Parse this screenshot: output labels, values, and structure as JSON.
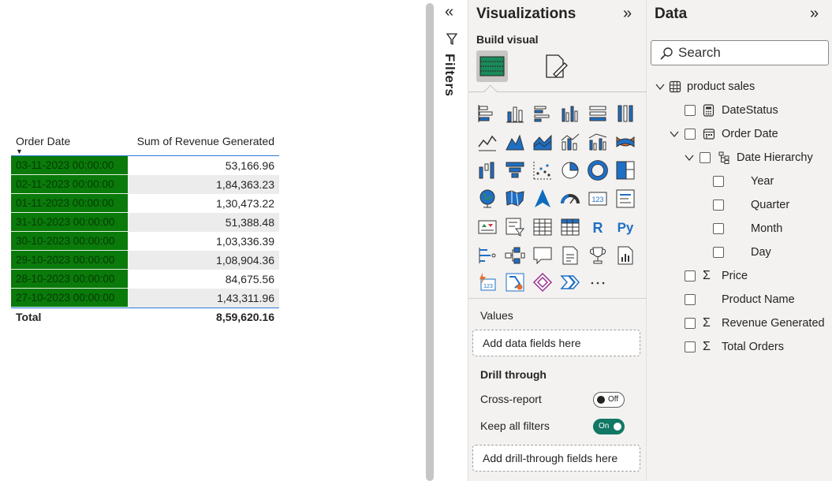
{
  "table": {
    "col_date": "Order Date",
    "col_revenue": "Sum of Revenue Generated",
    "rows": [
      {
        "date": "03-11-2023 00:00:00",
        "revenue": "53,166.96"
      },
      {
        "date": "02-11-2023 00:00:00",
        "revenue": "1,84,363.23"
      },
      {
        "date": "01-11-2023 00:00:00",
        "revenue": "1,30,473.22"
      },
      {
        "date": "31-10-2023 00:00:00",
        "revenue": "51,388.48"
      },
      {
        "date": "30-10-2023 00:00:00",
        "revenue": "1,03,336.39"
      },
      {
        "date": "29-10-2023 00:00:00",
        "revenue": "1,08,904.36"
      },
      {
        "date": "28-10-2023 00:00:00",
        "revenue": "84,675.56"
      },
      {
        "date": "27-10-2023 00:00:00",
        "revenue": "1,43,311.96"
      }
    ],
    "total_label": "Total",
    "total_value": "8,59,620.16",
    "date_cell_color": "#0a7a0a"
  },
  "filters": {
    "label": "Filters"
  },
  "visualizations": {
    "title": "Visualizations",
    "build_visual": "Build visual",
    "values_label": "Values",
    "values_drop": "Add data fields here",
    "drill_label": "Drill through",
    "cross_report": "Cross-report",
    "cross_toggle": "Off",
    "keep_filters": "Keep all filters",
    "keep_toggle": "On",
    "drill_drop": "Add drill-through fields here",
    "accent": "#117865"
  },
  "data_pane": {
    "title": "Data",
    "search_placeholder": "Search",
    "table_name": "product sales",
    "fields": {
      "date_status": "DateStatus",
      "order_date": "Order Date",
      "date_hierarchy": "Date Hierarchy",
      "year": "Year",
      "quarter": "Quarter",
      "month": "Month",
      "day": "Day",
      "price": "Price",
      "product_name": "Product Name",
      "revenue": "Revenue Generated",
      "total_orders": "Total Orders"
    }
  }
}
